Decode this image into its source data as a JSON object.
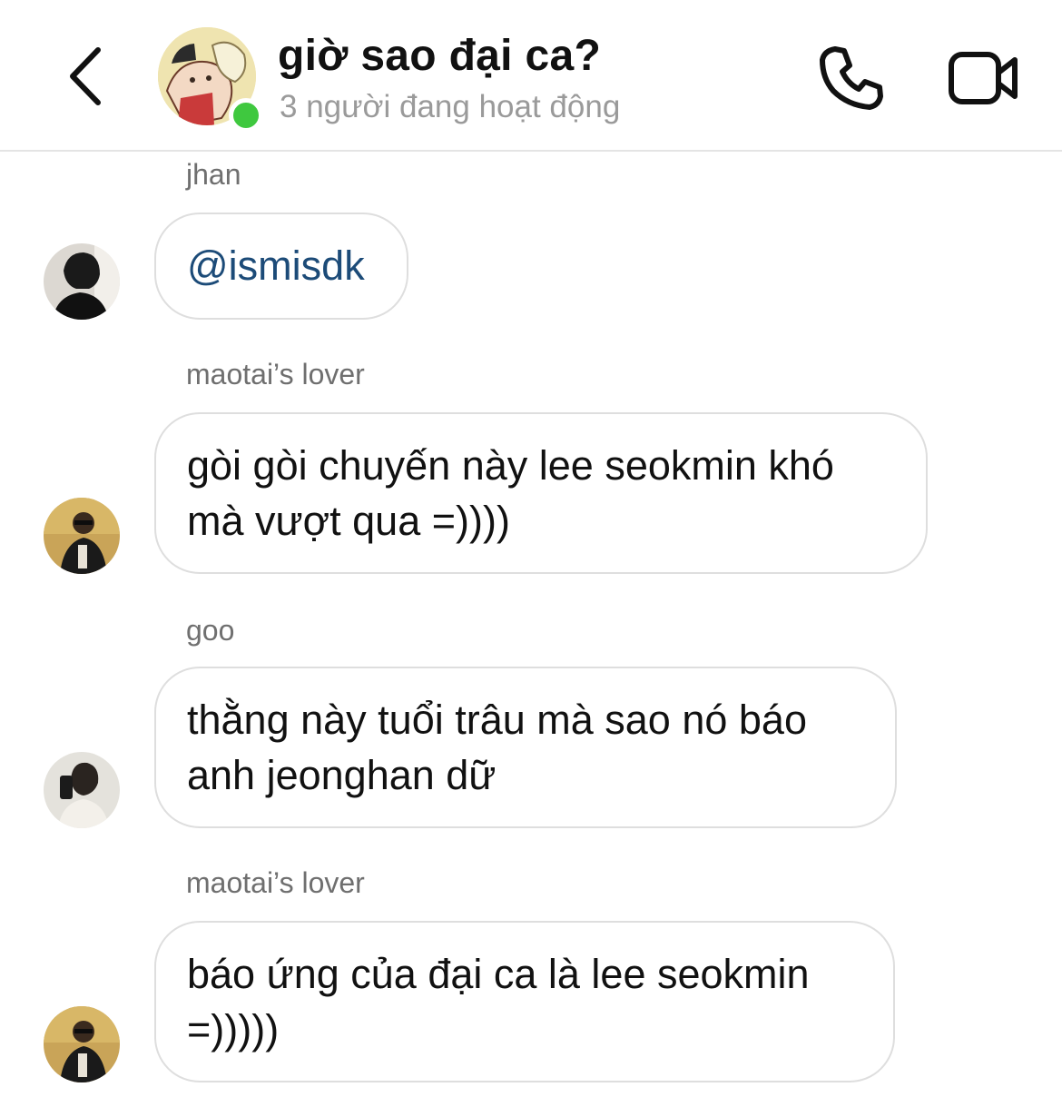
{
  "header": {
    "title": "giờ sao đại ca?",
    "status": "3 người đang hoạt động",
    "icons": {
      "back": "chevron-left-icon",
      "call": "phone-icon",
      "video": "video-camera-icon"
    },
    "online_color": "#3fc83f"
  },
  "messages": [
    {
      "sender": "jhan",
      "text": "@ismisdk",
      "is_mention": true
    },
    {
      "sender": "maotai’s lover",
      "text": "gòi gòi chuyến này lee seokmin khó mà vượt qua =))))",
      "is_mention": false
    },
    {
      "sender": "goo",
      "text": "thằng này tuổi trâu mà sao nó báo anh jeonghan dữ",
      "is_mention": false
    },
    {
      "sender": "maotai’s lover",
      "text": "báo ứng của đại ca là lee seokmin =)))))",
      "is_mention": false
    }
  ],
  "colors": {
    "mention": "#1c4b78",
    "sender_label": "#6f6f6f",
    "status_text": "#9a9a9a",
    "bubble_border": "#dedede"
  }
}
